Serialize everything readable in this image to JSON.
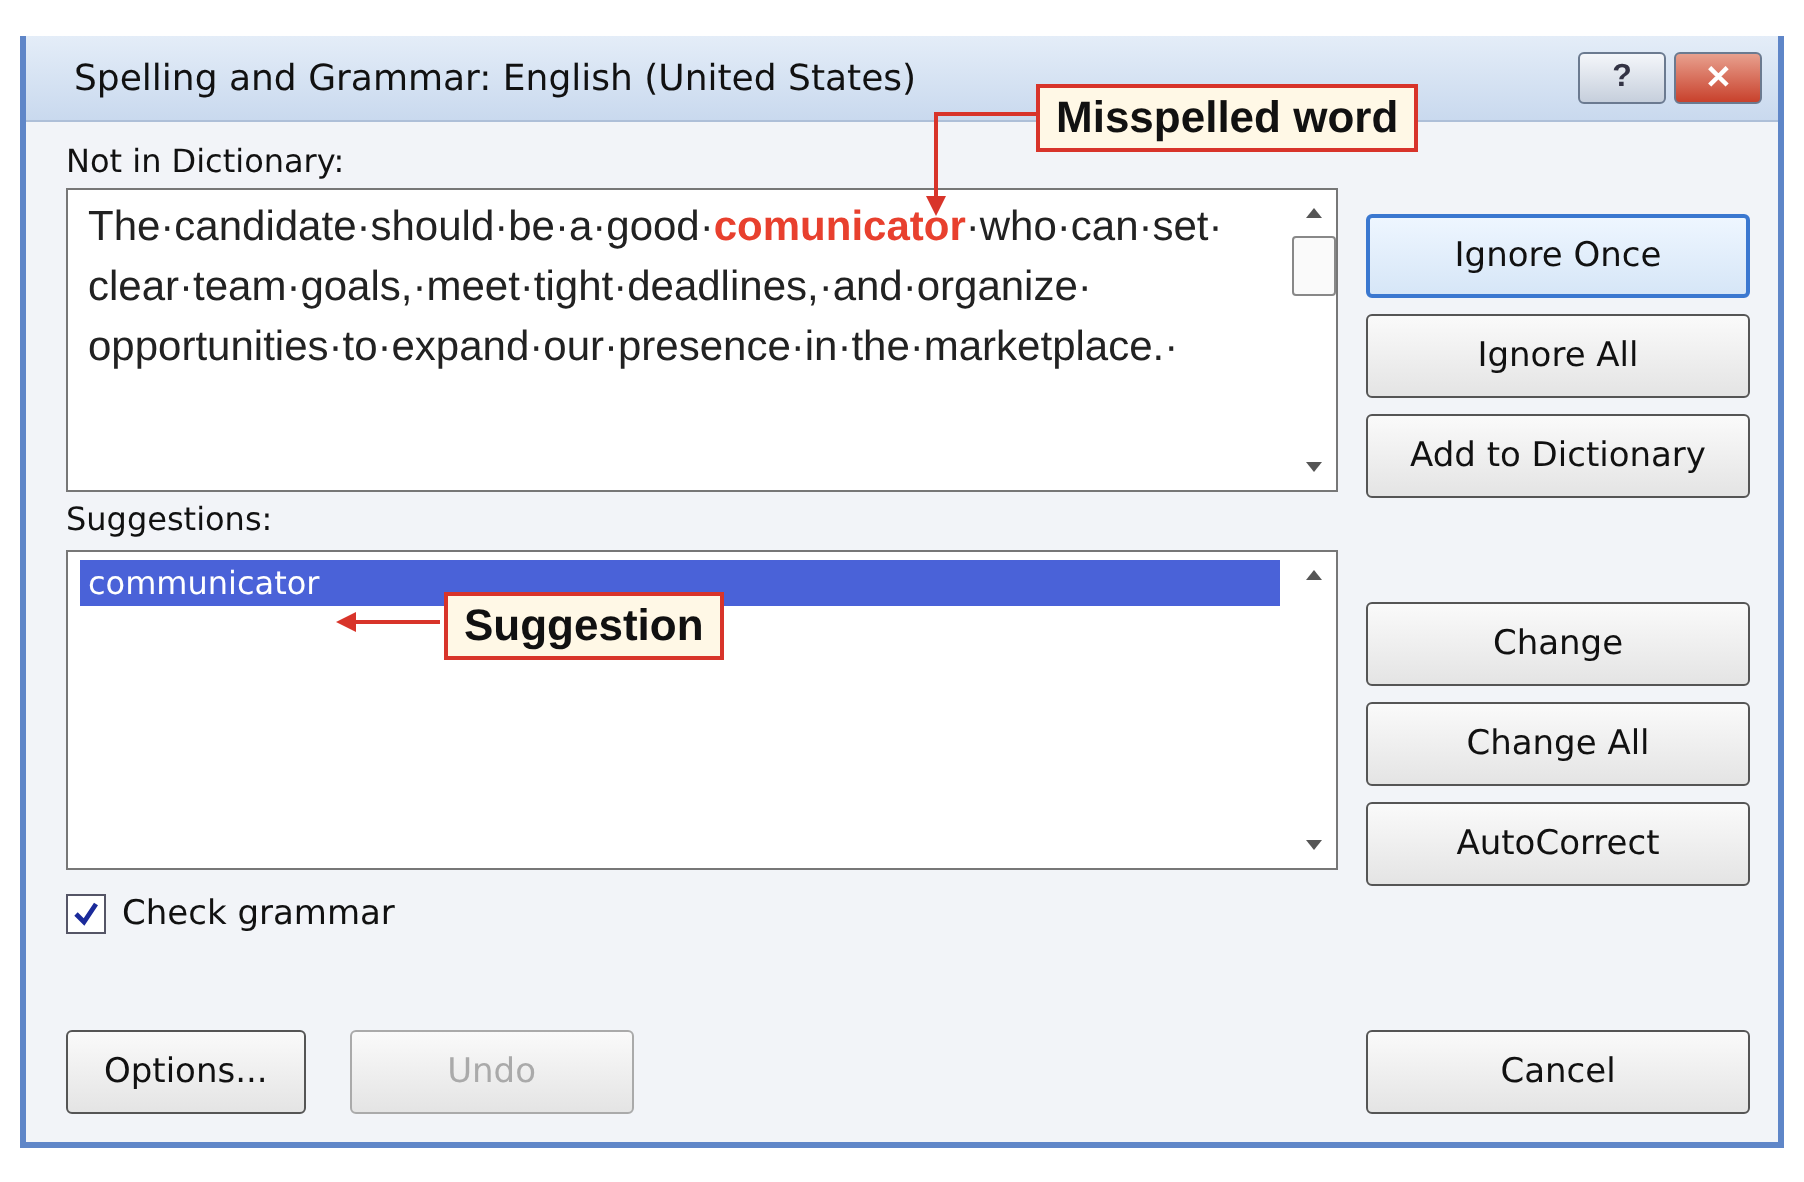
{
  "window": {
    "title": "Spelling and Grammar: English (United States)",
    "controls": [
      {
        "kind": "help",
        "label": "?"
      },
      {
        "kind": "close",
        "label": "✕"
      }
    ]
  },
  "not_in_dictionary": {
    "label": "Not in Dictionary:",
    "text": "The·​candidate·​should·​be·​a·​good·​**comunicator**·​who·​can·​set·​clear·​team·​goals,·​meet·​tight·​deadlines,·​and·​organize·​opportunities·​to·​expand·​our·​presence·​in·​the·​marketplace.·"
  },
  "suggestions": {
    "label": "Suggestions:",
    "items": [
      {
        "text": "communicator",
        "selected": true
      }
    ]
  },
  "top_buttons": [
    {
      "label": "Ignore Once",
      "default": true
    },
    {
      "label": "Ignore All",
      "default": false
    },
    {
      "label": "Add to Dictionary",
      "default": false
    }
  ],
  "mid_buttons": [
    {
      "label": "Change",
      "disabled": false
    },
    {
      "label": "Change All",
      "disabled": false
    },
    {
      "label": "AutoCorrect",
      "disabled": false
    }
  ],
  "check_grammar": {
    "label": "Check grammar",
    "checked": true
  },
  "bottom_buttons": [
    {
      "label": "Options...",
      "disabled": false
    },
    {
      "label": "Undo",
      "disabled": true
    }
  ],
  "cancel": {
    "label": "Cancel"
  },
  "callouts": [
    {
      "kind": "misspelled",
      "label": "Misspelled word"
    },
    {
      "kind": "suggestion",
      "label": "Suggestion"
    }
  ]
}
